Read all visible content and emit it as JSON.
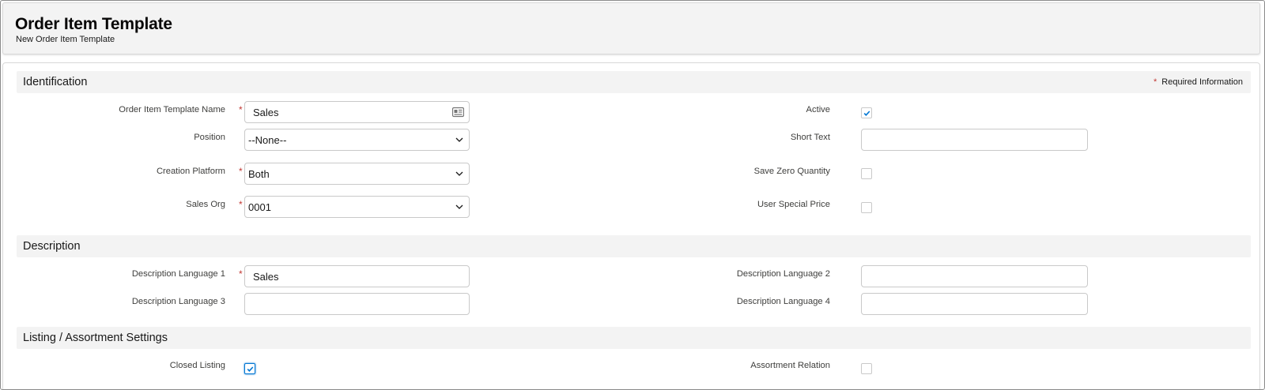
{
  "header": {
    "title": "Order Item Template",
    "subtitle": "New Order Item Template"
  },
  "required_info": {
    "marker": "*",
    "label": "Required Information"
  },
  "sections": {
    "identification": {
      "title": "Identification",
      "fields": {
        "name": {
          "label": "Order Item Template Name",
          "value": "Sales",
          "required": true,
          "icon": "contact-card-icon"
        },
        "position": {
          "label": "Position",
          "value": "--None--"
        },
        "creation_platform": {
          "label": "Creation Platform",
          "value": "Both",
          "required": true
        },
        "sales_org": {
          "label": "Sales Org",
          "value": "0001",
          "required": true
        },
        "active": {
          "label": "Active",
          "checked": true
        },
        "short_text": {
          "label": "Short Text",
          "value": ""
        },
        "save_zero_quantity": {
          "label": "Save Zero Quantity",
          "checked": false
        },
        "user_special_price": {
          "label": "User Special Price",
          "checked": false
        }
      }
    },
    "description": {
      "title": "Description",
      "fields": {
        "lang1": {
          "label": "Description Language 1",
          "value": "Sales",
          "required": true
        },
        "lang2": {
          "label": "Description Language 2",
          "value": ""
        },
        "lang3": {
          "label": "Description Language 3",
          "value": ""
        },
        "lang4": {
          "label": "Description Language 4",
          "value": ""
        }
      }
    },
    "listing": {
      "title": "Listing / Assortment Settings",
      "fields": {
        "closed_listing": {
          "label": "Closed Listing",
          "checked": true
        },
        "assortment_relation": {
          "label": "Assortment Relation",
          "checked": false
        }
      }
    }
  },
  "colors": {
    "required": "#c23934",
    "check": "#0176d3",
    "section_bg": "#f3f3f3",
    "border": "#c9c9c9"
  }
}
